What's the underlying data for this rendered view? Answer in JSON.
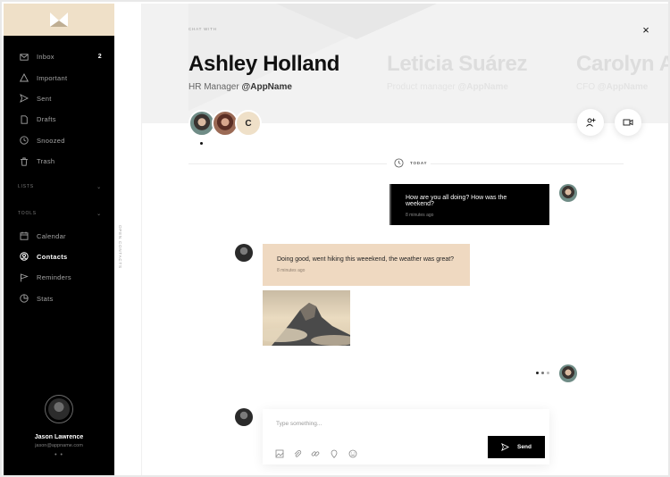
{
  "sidebar": {
    "nav": [
      {
        "label": "Inbox",
        "icon": "mail-icon",
        "count": "2"
      },
      {
        "label": "Important",
        "icon": "warning-icon",
        "count": ""
      },
      {
        "label": "Sent",
        "icon": "send-icon",
        "count": ""
      },
      {
        "label": "Drafts",
        "icon": "document-icon",
        "count": ""
      },
      {
        "label": "Snoozed",
        "icon": "clock-icon",
        "count": ""
      },
      {
        "label": "Trash",
        "icon": "trash-icon",
        "count": ""
      }
    ],
    "lists_label": "LISTS",
    "tools_label": "TOOLS",
    "tools": [
      {
        "label": "Calendar",
        "icon": "calendar-icon"
      },
      {
        "label": "Contacts",
        "icon": "user-circle-icon",
        "active": true
      },
      {
        "label": "Reminders",
        "icon": "flag-icon"
      },
      {
        "label": "Stats",
        "icon": "pie-chart-icon"
      }
    ],
    "profile": {
      "name": "Jason Lawrence",
      "email": "jason@appname.com",
      "more": "• •"
    }
  },
  "strip": {
    "label": "OPEN CONTACTS"
  },
  "header": {
    "eyebrow": "CHAT WITH",
    "contacts": [
      {
        "name": "Ashley Holland",
        "role": "HR Manager",
        "org": "@AppName"
      },
      {
        "name": "Leticia Suárez",
        "role": "Product manager",
        "org": "@AppName"
      },
      {
        "name": "Carolyn A",
        "role": "CFO",
        "org": "@AppName"
      }
    ],
    "avatar_initial": "C",
    "close": "×"
  },
  "chat": {
    "day_label": "TODAY",
    "messages": [
      {
        "text": "How are you all doing? How was the weekend?",
        "time": "8 minutes ago"
      },
      {
        "text": "Doing good, went hiking this weeekend, the weather was great?",
        "time": "8 minutes ago"
      }
    ],
    "composer": {
      "placeholder": "Type something...",
      "send_label": "Send"
    }
  },
  "colors": {
    "accent": "#efd9c1",
    "sidebar_bg": "#000000",
    "header_bg": "#f2f2f2"
  }
}
